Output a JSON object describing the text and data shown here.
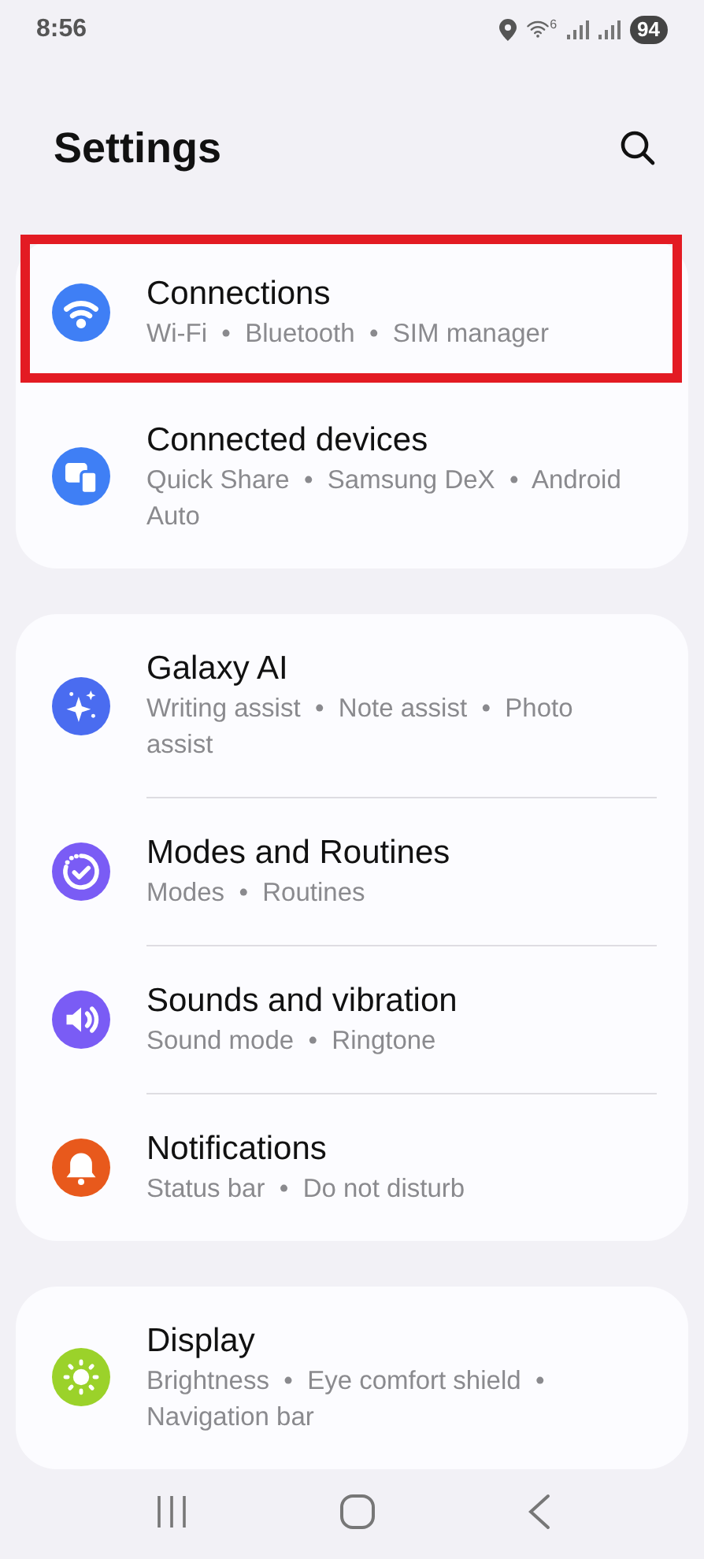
{
  "status_bar": {
    "time": "8:56",
    "wifi_badge": "6",
    "battery": "94"
  },
  "header": {
    "title": "Settings"
  },
  "groups": [
    {
      "items": [
        {
          "title": "Connections",
          "subtitle": "Wi-Fi  •  Bluetooth  •  SIM manager",
          "kind": "wifi",
          "color": "#3f7ff5",
          "highlighted": true
        },
        {
          "title": "Connected devices",
          "subtitle": "Quick Share  •  Samsung DeX  •  Android Auto",
          "kind": "devices",
          "color": "#3f7ff5",
          "highlighted": false
        }
      ]
    },
    {
      "items": [
        {
          "title": "Galaxy AI",
          "subtitle": "Writing assist  •  Note assist  •  Photo assist",
          "kind": "sparkle",
          "color": "#4a6cf0",
          "highlighted": false
        },
        {
          "title": "Modes and Routines",
          "subtitle": "Modes  •  Routines",
          "kind": "modes",
          "color": "#7a5cf5",
          "highlighted": false
        },
        {
          "title": "Sounds and vibration",
          "subtitle": "Sound mode  •  Ringtone",
          "kind": "sound",
          "color": "#7a5cf5",
          "highlighted": false
        },
        {
          "title": "Notifications",
          "subtitle": "Status bar  •  Do not disturb",
          "kind": "bell",
          "color": "#e8591c",
          "highlighted": false
        }
      ]
    },
    {
      "items": [
        {
          "title": "Display",
          "subtitle": "Brightness  •  Eye comfort shield  •  Navigation bar",
          "kind": "sun",
          "color": "#9bd22a",
          "highlighted": false
        }
      ]
    }
  ]
}
